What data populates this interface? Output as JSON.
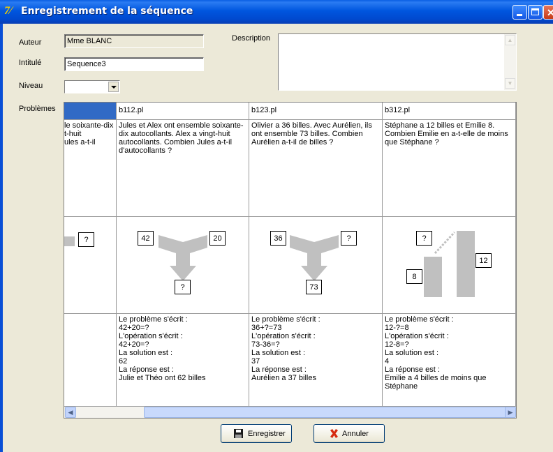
{
  "window": {
    "title": "Enregistrement de la séquence"
  },
  "form": {
    "author_label": "Auteur",
    "author_value": "Mme BLANC",
    "title_label": "Intitulé",
    "title_value": "Sequence3",
    "level_label": "Niveau",
    "level_value": "",
    "description_label": "Description",
    "description_value": "",
    "problems_label": "Problèmes"
  },
  "problems": {
    "partial": {
      "text": "le soixante-dix\nt-huit\nules a-t-il",
      "diagram_box": "?"
    },
    "columns": [
      {
        "file": "b112.pl",
        "statement": "Jules et Alex ont ensemble soixante-dix autocollants. Alex a vingt-huit autocollants. Combien Jules a-t-il d'autocollants ?",
        "boxes": [
          "42",
          "20",
          "?"
        ],
        "solution": "Le problème s'écrit :\n42+20=?\nL'opération s'écrit :\n42+20=?\nLa solution est :\n62\nLa réponse est :\nJulie et Théo ont 62 billes"
      },
      {
        "file": "b123.pl",
        "statement": "Olivier a 36 billes. Avec Aurélien, ils ont ensemble 73 billes. Combien Aurélien a-t-il de billes ?",
        "boxes": [
          "36",
          "?",
          "73"
        ],
        "solution": "Le problème s'écrit :\n36+?=73\nL'opération s'écrit :\n73-36=?\nLa solution est :\n37\nLa réponse est :\nAurélien a 37 billes"
      },
      {
        "file": "b312.pl",
        "statement": "Stéphane a 12 billes et Emilie 8. Combien Emilie en a-t-elle de moins que Stéphane ?",
        "boxes": [
          "?",
          "12",
          "8"
        ],
        "solution": "Le problème s'écrit :\n12-?=8\nL'opération s'écrit :\n12-8=?\nLa solution est :\n4\nLa réponse est :\nEmilie a 4 billes de moins que Stéphane"
      }
    ]
  },
  "buttons": {
    "save": "Enregistrer",
    "cancel": "Annuler"
  }
}
